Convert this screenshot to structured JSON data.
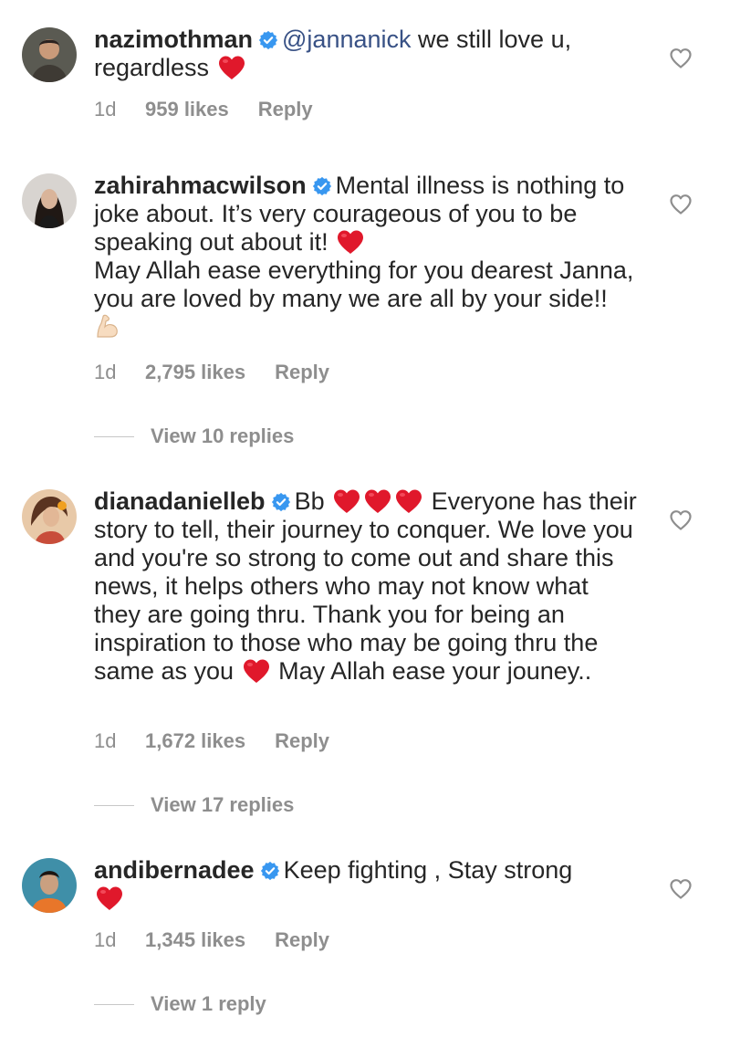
{
  "comments": [
    {
      "username": "nazimothman",
      "mention": "@jannanick",
      "text_parts": [
        "we still love u, regardless"
      ],
      "time": "1d",
      "likes": "959 likes",
      "reply_label": "Reply"
    },
    {
      "username": "zahirahmacwilson",
      "text_parts": [
        "Mental illness is nothing to joke about. It’s very courageous of you to be speaking out about it!",
        "May Allah ease everything for you dearest Janna, you are loved by many we are all by your side!!"
      ],
      "time": "1d",
      "likes": "2,795 likes",
      "reply_label": "Reply",
      "view_replies": "View 10 replies"
    },
    {
      "username": "dianadanielleb",
      "text_parts": [
        "Bb",
        "Everyone has their story to tell, their journey to conquer. We love you and you're so strong to come out and share this news, it helps others who may not know what they are going thru. Thank you for being an inspiration to those who may be going thru the same as you",
        "May Allah ease your jouney.."
      ],
      "time": "1d",
      "likes": "1,672 likes",
      "reply_label": "Reply",
      "view_replies": "View 17 replies"
    },
    {
      "username": "andibernadee",
      "text_parts": [
        "Keep fighting , Stay strong"
      ],
      "time": "1d",
      "likes": "1,345 likes",
      "reply_label": "Reply",
      "view_replies": "View 1 reply"
    }
  ],
  "icons": {
    "verified": "verified-badge-icon",
    "heart_emoji": "red-heart-emoji",
    "flex_emoji": "flexed-biceps-emoji",
    "like": "heart-outline-icon"
  },
  "colors": {
    "text": "#262626",
    "muted": "#8e8e8e",
    "verified": "#3897f0",
    "mention": "#385185",
    "heart": "#e0182b"
  }
}
